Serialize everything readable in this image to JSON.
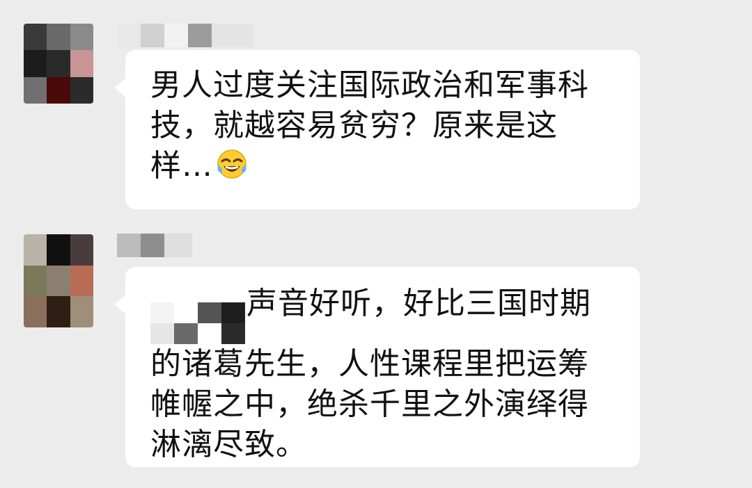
{
  "messages": [
    {
      "text": "男人过度关注国际政治和军事科技，就越容易贫穷？原来是这样…",
      "emoji": "face-with-tears-of-joy"
    },
    {
      "text": "声音好听，好比三国时期的诸葛先生，人性课程里把运筹帷幄之中，绝杀千里之外演绎得淋漓尽致。"
    }
  ],
  "colors": {
    "background": "#ececec",
    "bubble": "#ffffff",
    "text": "#111111"
  }
}
